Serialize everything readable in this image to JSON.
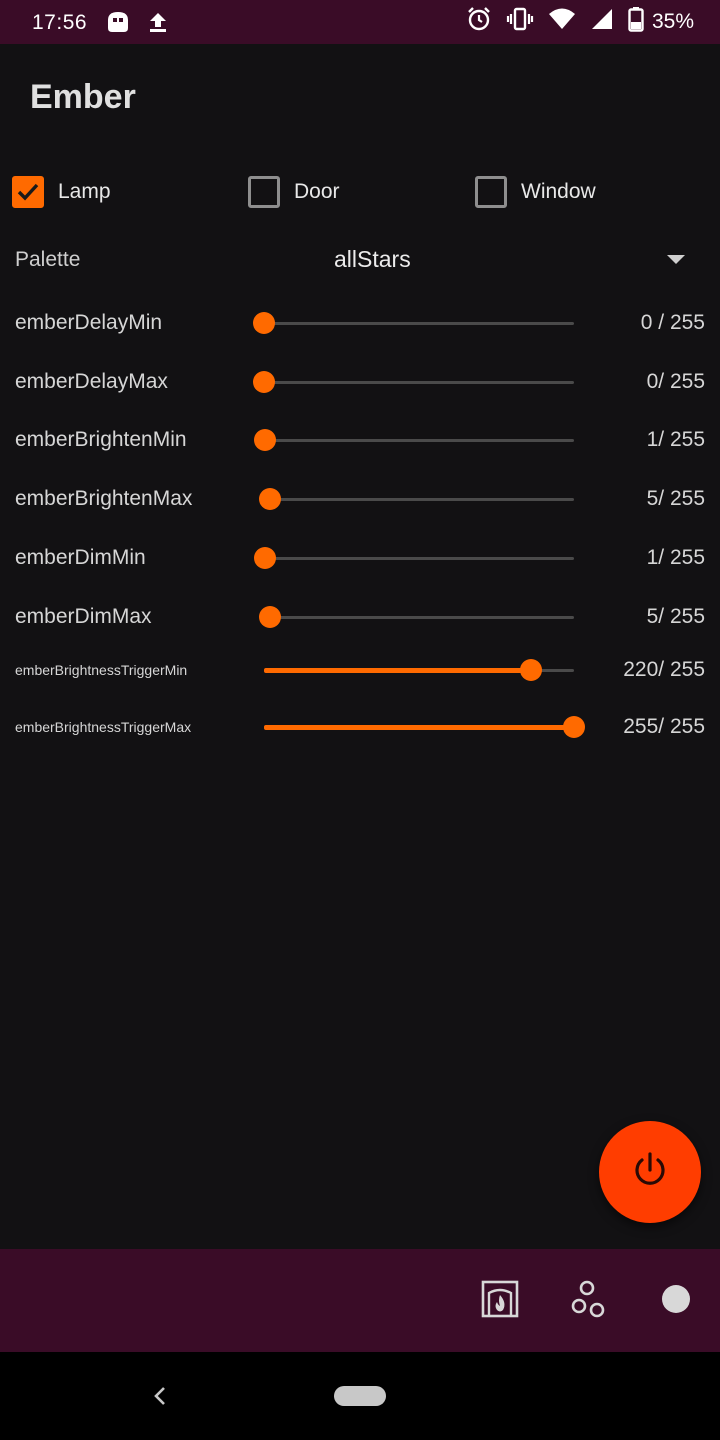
{
  "status_bar": {
    "time": "17:56",
    "battery_percent": "35%",
    "left_icons": [
      "app-notification-icon",
      "upload-icon"
    ],
    "right_icons": [
      "alarm-icon",
      "vibrate-icon",
      "wifi-icon",
      "signal-icon",
      "battery-icon"
    ]
  },
  "app": {
    "title": "Ember"
  },
  "checkboxes": [
    {
      "label": "Lamp",
      "checked": true
    },
    {
      "label": "Door",
      "checked": false
    },
    {
      "label": "Window",
      "checked": false
    }
  ],
  "palette": {
    "label": "Palette",
    "value": "allStars"
  },
  "sliders": [
    {
      "label": "emberDelayMin",
      "value": 0,
      "max": 255,
      "display": "0 / 255"
    },
    {
      "label": "emberDelayMax",
      "value": 0,
      "max": 255,
      "display": "0/ 255"
    },
    {
      "label": "emberBrightenMin",
      "value": 1,
      "max": 255,
      "display": "1/ 255"
    },
    {
      "label": "emberBrightenMax",
      "value": 5,
      "max": 255,
      "display": "5/ 255"
    },
    {
      "label": "emberDimMin",
      "value": 1,
      "max": 255,
      "display": "1/ 255"
    },
    {
      "label": "emberDimMax",
      "value": 5,
      "max": 255,
      "display": "5/ 255"
    },
    {
      "label": "emberBrightnessTriggerMin",
      "value": 220,
      "max": 255,
      "display": "220/ 255"
    },
    {
      "label": "emberBrightnessTriggerMax",
      "value": 255,
      "max": 255,
      "display": "255/ 255"
    }
  ],
  "fab": {
    "icon": "power-icon",
    "color": "#ff3d00"
  },
  "bottom_nav": {
    "icons": [
      "fireplace-icon",
      "circles-icon",
      "dot-icon"
    ]
  },
  "colors": {
    "accent": "#ff6a00",
    "status_bar_bg": "#3a0c27",
    "background": "#121113"
  }
}
